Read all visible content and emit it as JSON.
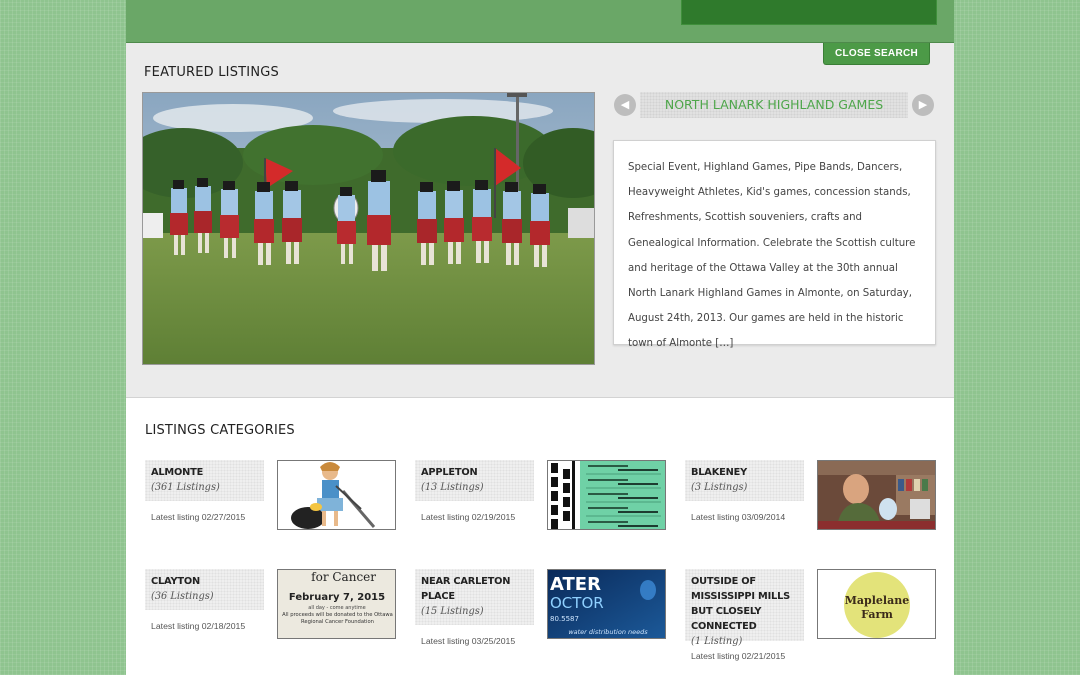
{
  "header": {
    "close_search_label": "CLOSE SEARCH"
  },
  "featured": {
    "section_title": "FEATURED LISTINGS",
    "listing_title": "NORTH LANARK HIGHLAND GAMES",
    "description": "Special Event, Highland Games, Pipe Bands, Dancers, Heavyweight Athletes, Kid's games, concession stands, Refreshments, Scottish souveniers, crafts and Genealogical Information. Celebrate the Scottish culture and heritage of the Ottawa Valley at the 30th annual North Lanark Highland Games in Almonte, on Saturday, August 24th, 2013. Our games are held in the historic town of Almonte […]",
    "prev_icon": "chevron-left-icon",
    "next_icon": "chevron-right-icon"
  },
  "categories": {
    "section_title": "LISTINGS CATEGORIES",
    "items": [
      {
        "name": "ALMONTE",
        "count": "(361 Listings)",
        "latest": "Latest listing 02/27/2015"
      },
      {
        "name": "APPLETON",
        "count": "(13 Listings)",
        "latest": "Latest listing 02/19/2015"
      },
      {
        "name": "BLAKENEY",
        "count": "(3 Listings)",
        "latest": "Latest listing 03/09/2014"
      },
      {
        "name": "CLAYTON",
        "count": "(36 Listings)",
        "latest": "Latest listing 02/18/2015"
      },
      {
        "name": "NEAR CARLETON PLACE",
        "count": "(15 Listings)",
        "latest": "Latest listing 03/25/2015"
      },
      {
        "name": "OUTSIDE OF MISSISSIPPI MILLS BUT CLOSELY CONNECTED",
        "count": "(1 Listing)",
        "latest": "Latest listing 02/21/2015"
      }
    ],
    "thumb_text": {
      "cancer_top": "for Cancer",
      "cancer_date": "February 7, 2015",
      "cancer_sub": "all day - come anytime",
      "cancer_note": "All proceeds will be donated to the Ottawa Regional Cancer Foundation",
      "water_big_1": "ATER",
      "water_big_2": "OCTOR",
      "water_phone": "80.5587",
      "water_tag": "water distribution needs",
      "maple_line1": "Maplelane",
      "maple_line2": "Farm"
    }
  },
  "colors": {
    "page_bg": "#8fc48f",
    "header_green": "#6aa767",
    "accent_green": "#4ea64a",
    "button_green": "#4c9a47"
  }
}
